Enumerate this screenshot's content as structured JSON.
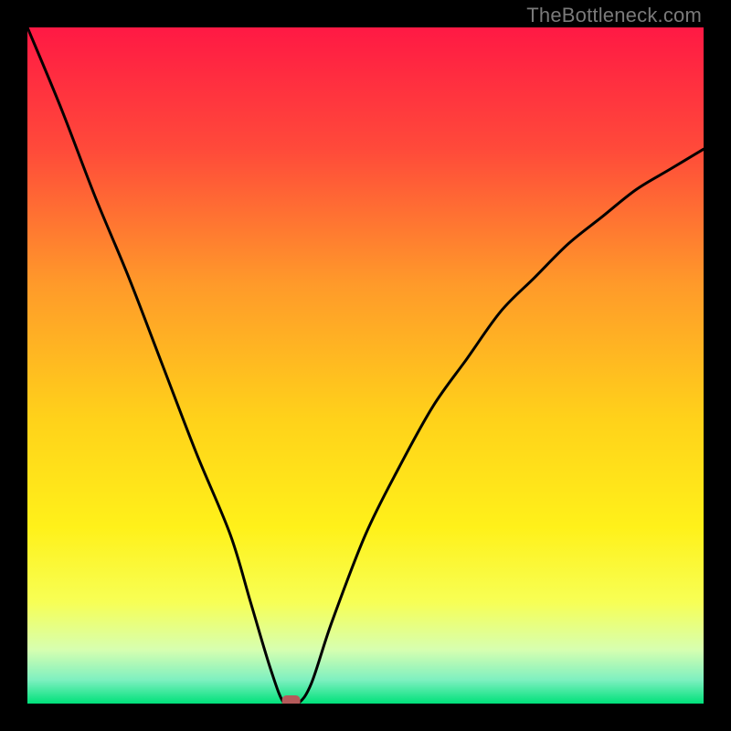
{
  "watermark": "TheBottleneck.com",
  "chart_data": {
    "type": "line",
    "title": "",
    "xlabel": "",
    "ylabel": "",
    "xlim": [
      0,
      100
    ],
    "ylim": [
      0,
      100
    ],
    "grid": false,
    "series": [
      {
        "name": "bottleneck-curve",
        "x": [
          0,
          5,
          10,
          15,
          20,
          25,
          30,
          33,
          36,
          38,
          40,
          42,
          45,
          50,
          55,
          60,
          65,
          70,
          75,
          80,
          85,
          90,
          95,
          100
        ],
        "y": [
          100,
          88,
          75,
          63,
          50,
          37,
          25,
          15,
          5,
          0,
          0,
          3,
          12,
          25,
          35,
          44,
          51,
          58,
          63,
          68,
          72,
          76,
          79,
          82
        ]
      }
    ],
    "marker": {
      "name": "optimal-point",
      "x": 39,
      "y": 0,
      "shape": "rounded-rect",
      "color": "#b55a5a"
    },
    "gradient_background": {
      "stops": [
        {
          "offset": 0.0,
          "color": "#ff1944"
        },
        {
          "offset": 0.18,
          "color": "#ff4a3a"
        },
        {
          "offset": 0.38,
          "color": "#ff9a2a"
        },
        {
          "offset": 0.58,
          "color": "#ffd21a"
        },
        {
          "offset": 0.74,
          "color": "#fff11a"
        },
        {
          "offset": 0.85,
          "color": "#f7ff55"
        },
        {
          "offset": 0.92,
          "color": "#d7ffb0"
        },
        {
          "offset": 0.965,
          "color": "#7ef0c0"
        },
        {
          "offset": 1.0,
          "color": "#00e17a"
        }
      ]
    }
  }
}
